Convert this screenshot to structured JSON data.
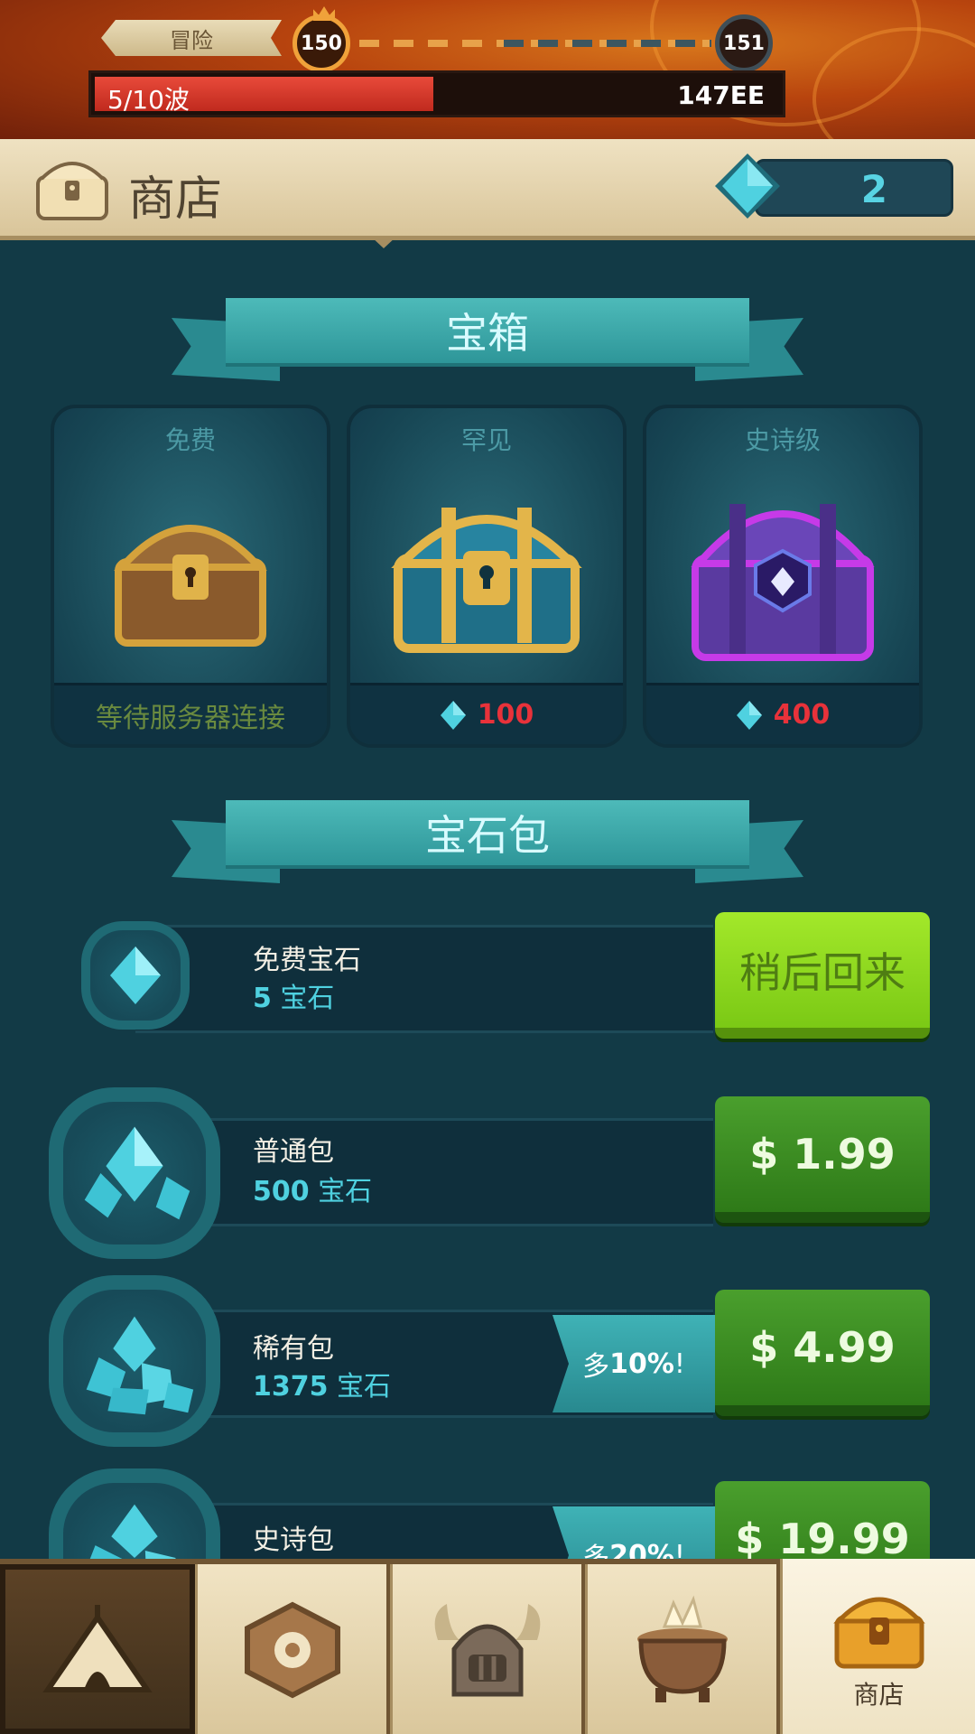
{
  "top_bar": {
    "mode_label": "冒险",
    "current_level": "150",
    "next_level": "151",
    "wave_text": "5/10波",
    "wave_progress": 0.5,
    "score": "147EE"
  },
  "header": {
    "title": "商店",
    "gem_count": "2"
  },
  "chests_section": {
    "title": "宝箱",
    "chests": [
      {
        "label": "免费",
        "status": "等待服务器连接",
        "price": ""
      },
      {
        "label": "罕见",
        "status": "",
        "price": "100"
      },
      {
        "label": "史诗级",
        "status": "",
        "price": "400"
      }
    ]
  },
  "gem_packs_section": {
    "title": "宝石包",
    "packs": [
      {
        "name": "免费宝石",
        "amount_num": "5",
        "amount_unit": "宝石",
        "button": "稍后回来",
        "bonus_pre": "",
        "bonus_val": "",
        "bonus_post": ""
      },
      {
        "name": "普通包",
        "amount_num": "500",
        "amount_unit": "宝石",
        "button": "$ 1.99",
        "bonus_pre": "",
        "bonus_val": "",
        "bonus_post": ""
      },
      {
        "name": "稀有包",
        "amount_num": "1375",
        "amount_unit": "宝石",
        "button": "$ 4.99",
        "bonus_pre": "多",
        "bonus_val": "10%",
        "bonus_post": "!"
      },
      {
        "name": "史诗包",
        "amount_num": "",
        "amount_unit": "",
        "button": "$ 19.99",
        "bonus_pre": "多",
        "bonus_val": "20%",
        "bonus_post": "!"
      }
    ]
  },
  "bottom_nav": {
    "items": [
      {
        "icon": "camp-tent-icon",
        "label": ""
      },
      {
        "icon": "hexagon-rune-icon",
        "label": ""
      },
      {
        "icon": "viking-helmet-icon",
        "label": ""
      },
      {
        "icon": "cauldron-icon",
        "label": ""
      },
      {
        "icon": "treasure-chest-icon",
        "label": "商店"
      }
    ]
  },
  "colors": {
    "background": "#123a46",
    "gem": "#4fd1e0",
    "price_red": "#e8323a",
    "buy_green": "#3a8f22",
    "later_green": "#8fd81f"
  }
}
